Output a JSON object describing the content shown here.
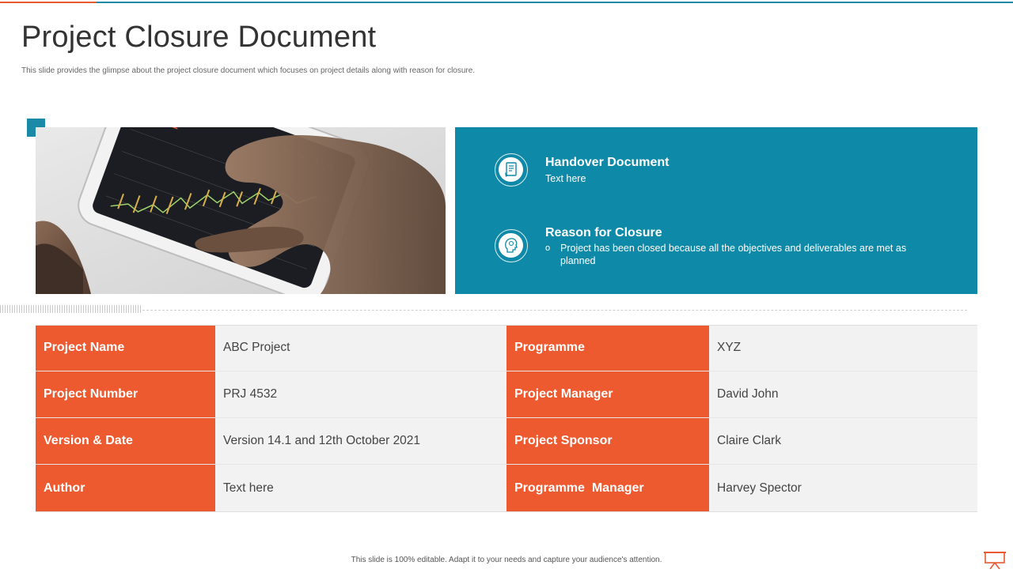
{
  "title": "Project Closure Document",
  "subtitle": "This slide provides the glimpse about the project closure document which focuses on project details along with reason for closure.",
  "colors": {
    "accent_orange": "#ee5a30",
    "accent_teal": "#0e89a7",
    "cell_bg": "#f2f2f2"
  },
  "panel": {
    "items": [
      {
        "icon": "document-icon",
        "heading": "Handover Document",
        "text": "Text here"
      },
      {
        "icon": "head-idea-icon",
        "heading": "Reason for Closure",
        "bullet": "o",
        "text": "Project has been closed because all the objectives and deliverables  are met as planned"
      }
    ]
  },
  "table": {
    "rows": [
      {
        "left_label": "Project Name",
        "left_value": "ABC Project",
        "right_label": "Programme",
        "right_value": "XYZ"
      },
      {
        "left_label": "Project Number",
        "left_value": "PRJ 4532",
        "right_label": "Project Manager",
        "right_value": "David John"
      },
      {
        "left_label": "Version & Date",
        "left_value": "Version 14.1 and 12th October 2021",
        "right_label": "Project Sponsor",
        "right_value": "Claire Clark"
      },
      {
        "left_label": "Author",
        "left_value": "Text here",
        "right_label": "Programme  Manager",
        "right_value": "Harvey Spector"
      }
    ]
  },
  "footer": "This slide is 100% editable. Adapt it to your needs and capture your audience's attention."
}
